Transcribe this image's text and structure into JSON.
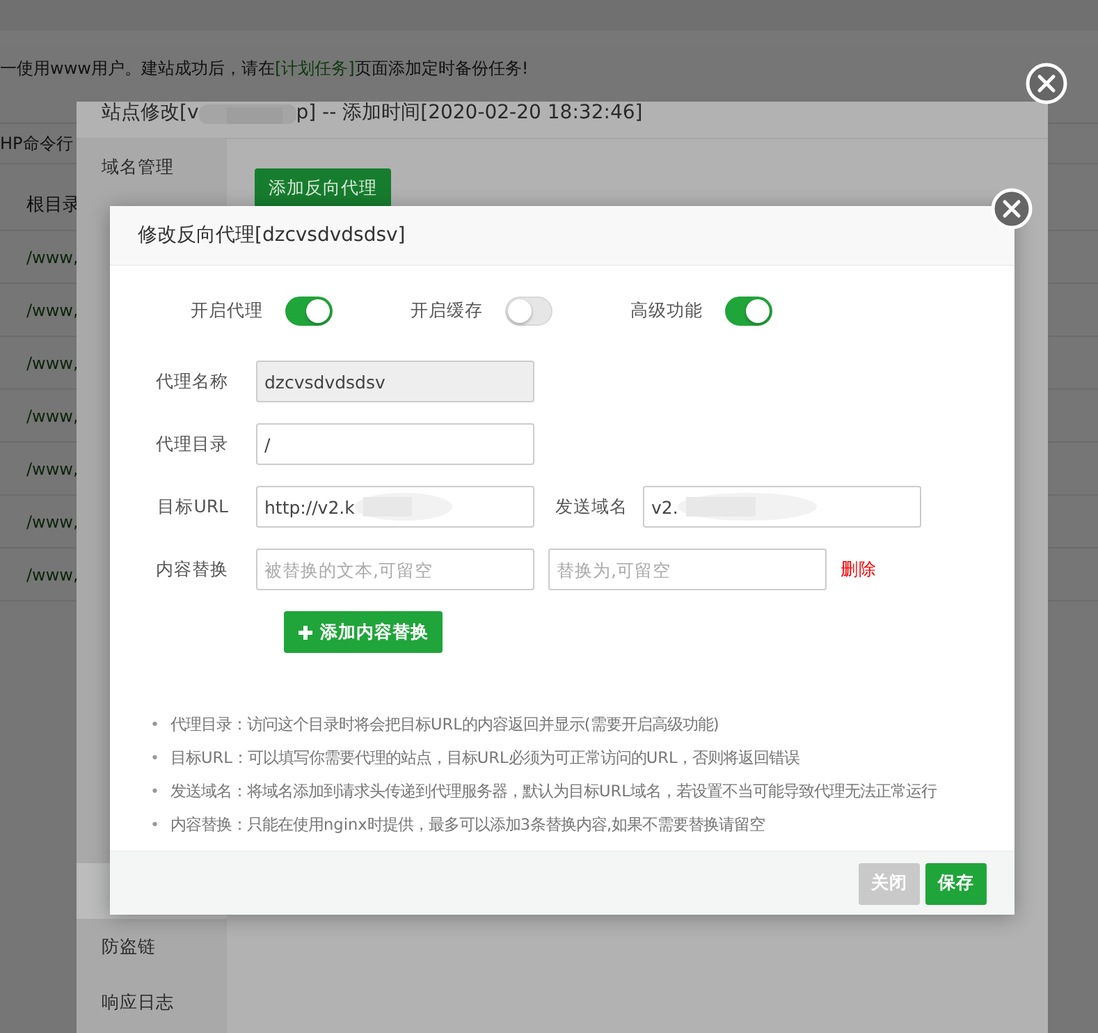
{
  "background_page": {
    "notice": {
      "before": "一使用www用户。建站成功后，请在",
      "link": "[计划任务]",
      "after": "页面添加定时备份任务!"
    },
    "toolbar_tab": "HP命令行",
    "table": {
      "columns": [
        "根目录"
      ],
      "rows": [
        "/www,",
        "/www,",
        "/www,",
        "/www,",
        "/www,",
        "/www,",
        "/www,"
      ]
    }
  },
  "site_dialog": {
    "title_prefix": "站点修改[v",
    "title_suffix": "p] -- 添加时间[2020-02-20 18:32:46]",
    "redacted": true,
    "sidebar": [
      {
        "label": "域名管理",
        "selected": false
      },
      {
        "selected": false
      },
      {
        "selected": false
      },
      {
        "selected": false
      },
      {
        "selected": false
      },
      {
        "selected": false
      },
      {
        "selected": false
      },
      {
        "selected": false
      },
      {
        "selected": false
      },
      {
        "selected": false
      },
      {
        "selected": false
      },
      {
        "selected": false
      },
      {
        "selected": false
      },
      {
        "selected": true
      },
      {
        "label": "防盗链",
        "selected": false
      },
      {
        "label": "响应日志",
        "selected": false
      }
    ],
    "add_button": "添加反向代理"
  },
  "proxy_dialog": {
    "title": "修改反向代理[dzcvsdvdsdsv]",
    "switches": [
      {
        "label": "开启代理",
        "on": true
      },
      {
        "label": "开启缓存",
        "on": false
      },
      {
        "label": "高级功能",
        "on": true
      }
    ],
    "rows": [
      {
        "kind": "single",
        "label": "代理名称",
        "value": "dzcvsdvdsdsv",
        "disabled": true
      },
      {
        "kind": "single",
        "label": "代理目录",
        "value": "/",
        "disabled": false
      },
      {
        "kind": "pair",
        "label": "目标URL",
        "value": "http://v2.k",
        "label_2": "发送域名",
        "value_2": "v2.",
        "redacted": true
      },
      {
        "kind": "replace",
        "label": "内容替换",
        "placeholder": "被替换的文本,可留空",
        "placeholder_2": "替换为,可留空",
        "action": "删除"
      }
    ],
    "add_replace_button": "添加内容替换",
    "bullet": "•",
    "notes": [
      "代理目录：访问这个目录时将会把目标URL的内容返回并显示(需要开启高级功能)",
      "目标URL：可以填写你需要代理的站点，目标URL必须为可正常访问的URL，否则将返回错误",
      "发送域名：将域名添加到请求头传递到代理服务器，默认为目标URL域名，若设置不当可能导致代理无法正常运行",
      "内容替换：只能在使用nginx时提供，最多可以添加3条替换内容,如果不需要替换请留空"
    ],
    "buttons": [
      {
        "label": "关闭",
        "disabled": true
      },
      {
        "label": "保存",
        "disabled": false
      }
    ]
  }
}
